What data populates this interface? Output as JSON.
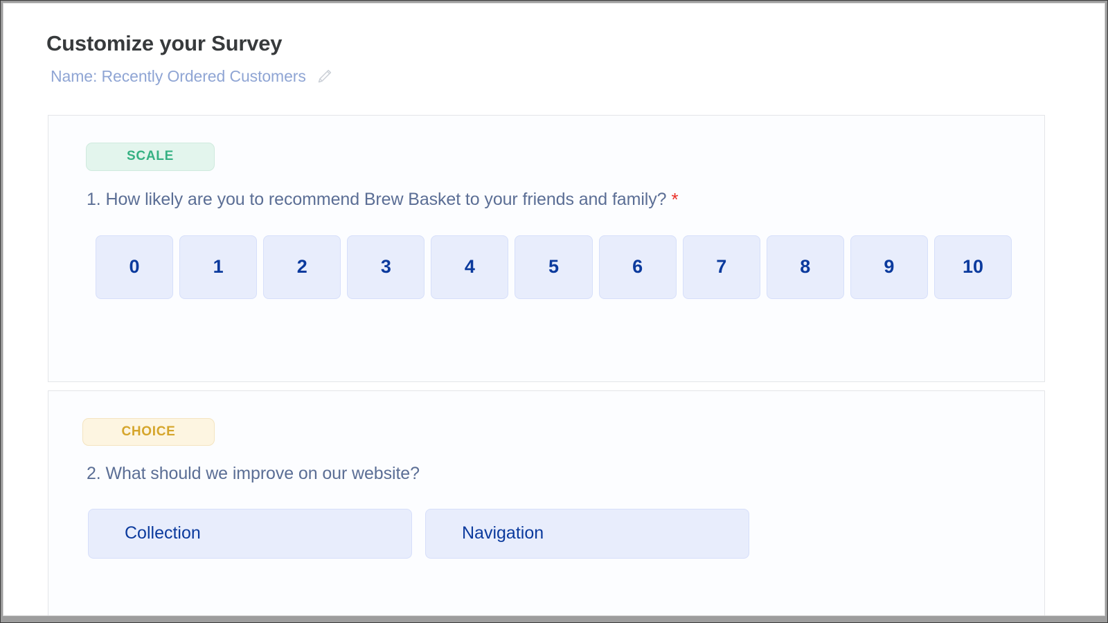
{
  "header": {
    "title": "Customize your Survey",
    "name_label": "Name: Recently Ordered Customers",
    "edit_icon": "pencil-icon"
  },
  "colors": {
    "title": "#373a3c",
    "name": "#8fa5d4",
    "question": "#5b6e95",
    "required": "#ea2f27",
    "option_text": "#0b3a9d",
    "option_bg": "#e8edfc",
    "option_border": "#d6dffa",
    "scale_badge_bg": "#e3f5ed",
    "scale_badge_text": "#35b183",
    "choice_badge_bg": "#fdf5e1",
    "choice_badge_text": "#d5a52b",
    "card_border": "#e3e5e8",
    "card_bg": "#fcfdff"
  },
  "questions": [
    {
      "badge": "SCALE",
      "number": "1.",
      "text": "How likely are you to recommend Brew Basket to your friends and family?",
      "required": true,
      "required_marker": "*",
      "options": [
        "0",
        "1",
        "2",
        "3",
        "4",
        "5",
        "6",
        "7",
        "8",
        "9",
        "10"
      ]
    },
    {
      "badge": "CHOICE",
      "number": "2.",
      "text": "What should we improve on our website?",
      "required": false,
      "required_marker": "",
      "options": [
        "Collection",
        "Navigation"
      ]
    }
  ]
}
